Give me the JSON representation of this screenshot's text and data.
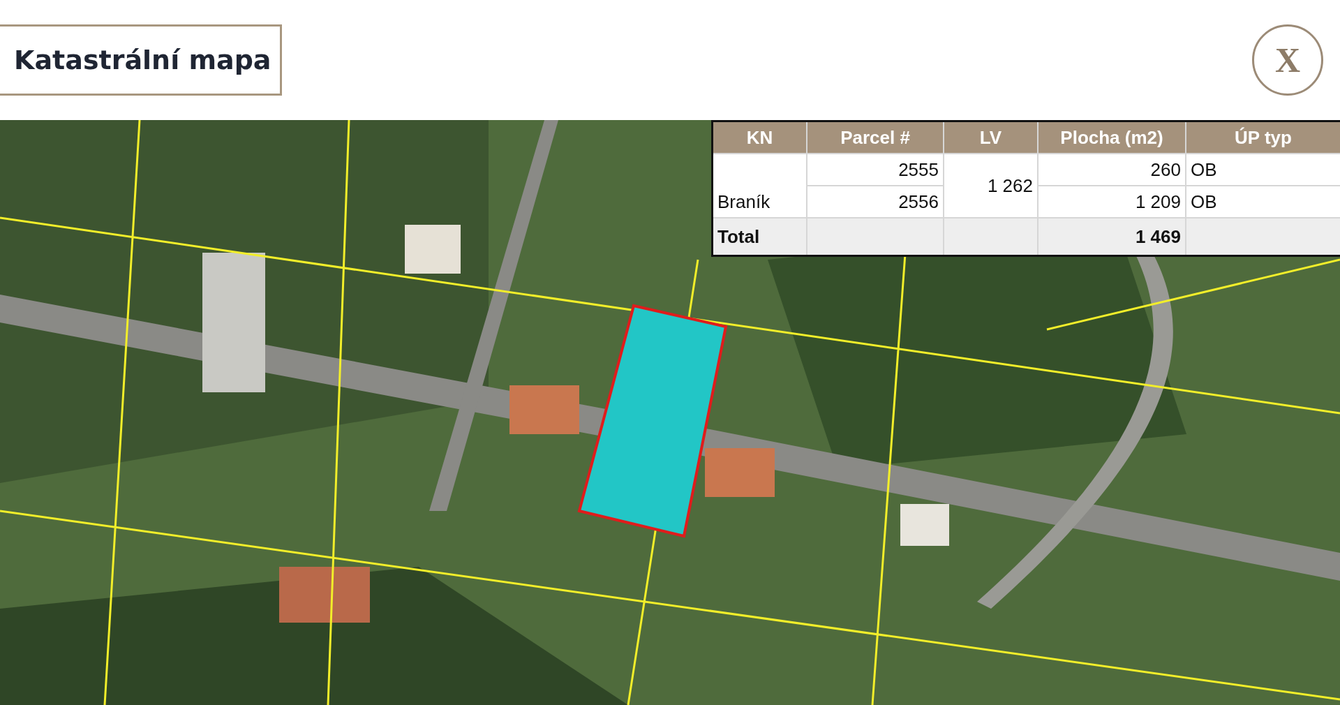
{
  "header": {
    "title": "Katastrální mapa",
    "close_label": "X"
  },
  "table": {
    "columns": [
      "KN",
      "Parcel #",
      "LV",
      "Plocha (m2)",
      "ÚP typ"
    ],
    "kn": "Braník",
    "lv": "1 262",
    "rows": [
      {
        "parcel": "2555",
        "plocha": "260",
        "up": "OB"
      },
      {
        "parcel": "2556",
        "plocha": "1 209",
        "up": "OB"
      }
    ],
    "total": {
      "label": "Total",
      "plocha": "1 469"
    }
  }
}
